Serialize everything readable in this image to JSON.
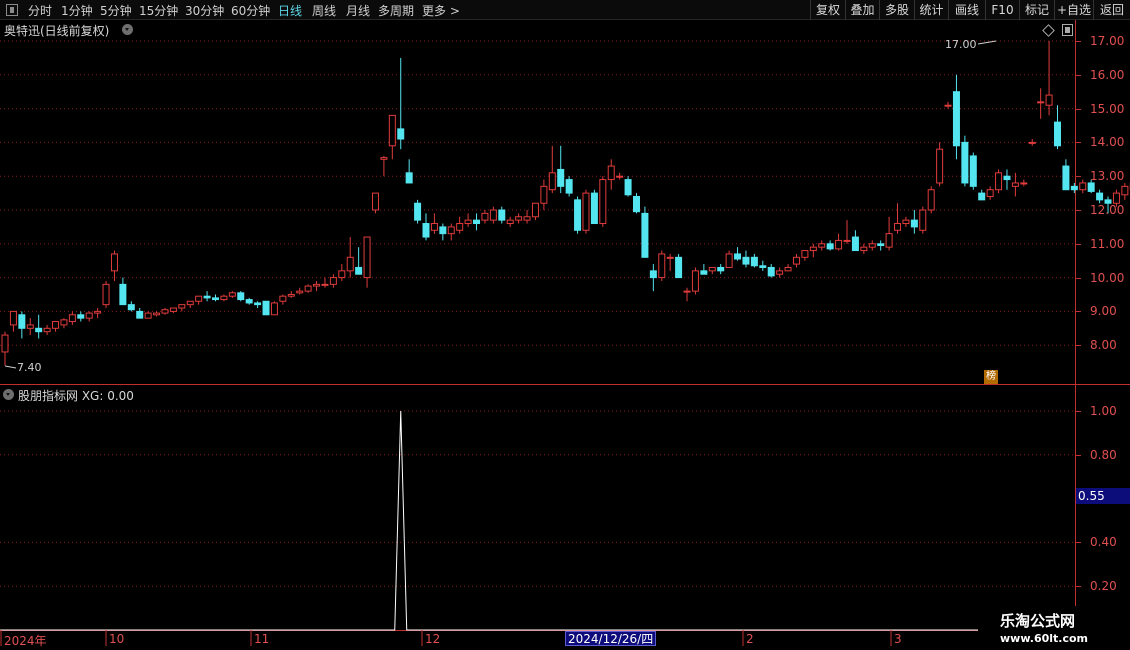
{
  "toolbar": {
    "tabs": [
      {
        "label": "分时"
      },
      {
        "label": "1分钟"
      },
      {
        "label": "5分钟"
      },
      {
        "label": "15分钟"
      },
      {
        "label": "30分钟"
      },
      {
        "label": "60分钟"
      },
      {
        "label": "日线"
      },
      {
        "label": "周线"
      },
      {
        "label": "月线"
      },
      {
        "label": "多周期"
      },
      {
        "label": "更多 >"
      }
    ],
    "active_tab": "日线",
    "right_buttons": [
      "复权",
      "叠加",
      "多股",
      "统计",
      "画线",
      "F10",
      "标记",
      "+自选",
      "返回"
    ]
  },
  "main_pane": {
    "title": "奥特迅(日线前复权)",
    "price_axis_labels": [
      "17.00",
      "16.00",
      "15.00",
      "14.00",
      "13.00",
      "12.00",
      "11.00",
      "10.00",
      "9.00",
      "8.00"
    ],
    "high_marker": "17.00",
    "low_marker": "7.40",
    "badge": "榜"
  },
  "indicator_pane": {
    "title": "股朋指标网 XG: 0.00",
    "axis_labels": [
      "1.00",
      "0.80",
      "0.40",
      "0.20"
    ],
    "cursor_value": "0.55"
  },
  "date_axis": {
    "labels": [
      "2024年",
      "10",
      "11",
      "12",
      "2",
      "3"
    ],
    "highlight": "2024/12/26/四"
  },
  "watermark": {
    "title": "乐淘公式网",
    "url": "www.60lt.com"
  },
  "colors": {
    "up": "#e03c3c",
    "down": "#54e6f0",
    "grid": "#8a1a1a",
    "axis": "#c03030",
    "active_tab": "#5dd6e8"
  },
  "chart_data": {
    "type": "candlestick",
    "price_range": [
      7.4,
      17.0
    ],
    "candles": [
      {
        "o": 7.8,
        "h": 8.4,
        "l": 7.4,
        "c": 8.3
      },
      {
        "o": 8.6,
        "h": 9.0,
        "l": 8.4,
        "c": 9.0
      },
      {
        "o": 8.9,
        "h": 9.0,
        "l": 8.2,
        "c": 8.5
      },
      {
        "o": 8.5,
        "h": 8.8,
        "l": 8.3,
        "c": 8.6
      },
      {
        "o": 8.5,
        "h": 8.9,
        "l": 8.2,
        "c": 8.4
      },
      {
        "o": 8.4,
        "h": 8.6,
        "l": 8.3,
        "c": 8.5
      },
      {
        "o": 8.5,
        "h": 8.7,
        "l": 8.4,
        "c": 8.7
      },
      {
        "o": 8.6,
        "h": 8.8,
        "l": 8.5,
        "c": 8.75
      },
      {
        "o": 8.7,
        "h": 9.0,
        "l": 8.6,
        "c": 8.9
      },
      {
        "o": 8.9,
        "h": 9.0,
        "l": 8.7,
        "c": 8.8
      },
      {
        "o": 8.8,
        "h": 9.0,
        "l": 8.7,
        "c": 8.95
      },
      {
        "o": 8.95,
        "h": 9.1,
        "l": 8.8,
        "c": 9.0
      },
      {
        "o": 9.2,
        "h": 9.9,
        "l": 9.1,
        "c": 9.8
      },
      {
        "o": 10.2,
        "h": 10.8,
        "l": 9.9,
        "c": 10.7
      },
      {
        "o": 9.8,
        "h": 10.0,
        "l": 9.2,
        "c": 9.2
      },
      {
        "o": 9.2,
        "h": 9.3,
        "l": 9.0,
        "c": 9.05
      },
      {
        "o": 9.0,
        "h": 9.1,
        "l": 8.8,
        "c": 8.8
      },
      {
        "o": 8.8,
        "h": 9.0,
        "l": 8.8,
        "c": 8.95
      },
      {
        "o": 8.9,
        "h": 9.0,
        "l": 8.85,
        "c": 8.95
      },
      {
        "o": 8.95,
        "h": 9.1,
        "l": 8.9,
        "c": 9.05
      },
      {
        "o": 9.0,
        "h": 9.1,
        "l": 8.95,
        "c": 9.1
      },
      {
        "o": 9.1,
        "h": 9.2,
        "l": 9.0,
        "c": 9.2
      },
      {
        "o": 9.2,
        "h": 9.3,
        "l": 9.1,
        "c": 9.3
      },
      {
        "o": 9.3,
        "h": 9.4,
        "l": 9.2,
        "c": 9.45
      },
      {
        "o": 9.45,
        "h": 9.6,
        "l": 9.3,
        "c": 9.4
      },
      {
        "o": 9.4,
        "h": 9.5,
        "l": 9.3,
        "c": 9.35
      },
      {
        "o": 9.35,
        "h": 9.5,
        "l": 9.3,
        "c": 9.45
      },
      {
        "o": 9.45,
        "h": 9.6,
        "l": 9.4,
        "c": 9.55
      },
      {
        "o": 9.55,
        "h": 9.6,
        "l": 9.3,
        "c": 9.35
      },
      {
        "o": 9.35,
        "h": 9.4,
        "l": 9.2,
        "c": 9.25
      },
      {
        "o": 9.25,
        "h": 9.3,
        "l": 9.1,
        "c": 9.2
      },
      {
        "o": 9.3,
        "h": 9.3,
        "l": 8.9,
        "c": 8.9
      },
      {
        "o": 8.9,
        "h": 9.3,
        "l": 8.9,
        "c": 9.25
      },
      {
        "o": 9.3,
        "h": 9.5,
        "l": 9.2,
        "c": 9.45
      },
      {
        "o": 9.45,
        "h": 9.6,
        "l": 9.4,
        "c": 9.5
      },
      {
        "o": 9.55,
        "h": 9.7,
        "l": 9.5,
        "c": 9.6
      },
      {
        "o": 9.6,
        "h": 9.8,
        "l": 9.55,
        "c": 9.75
      },
      {
        "o": 9.75,
        "h": 9.9,
        "l": 9.6,
        "c": 9.8
      },
      {
        "o": 9.8,
        "h": 10.0,
        "l": 9.7,
        "c": 9.8
      },
      {
        "o": 9.8,
        "h": 10.1,
        "l": 9.7,
        "c": 10.0
      },
      {
        "o": 10.0,
        "h": 10.4,
        "l": 9.9,
        "c": 10.2
      },
      {
        "o": 10.2,
        "h": 11.2,
        "l": 10.0,
        "c": 10.6
      },
      {
        "o": 10.3,
        "h": 10.9,
        "l": 10.1,
        "c": 10.1
      },
      {
        "o": 10.0,
        "h": 11.2,
        "l": 9.7,
        "c": 11.2
      },
      {
        "o": 12.0,
        "h": 12.5,
        "l": 11.9,
        "c": 12.5
      },
      {
        "o": 13.5,
        "h": 13.6,
        "l": 13.0,
        "c": 13.55
      },
      {
        "o": 13.9,
        "h": 14.8,
        "l": 13.5,
        "c": 14.8
      },
      {
        "o": 14.4,
        "h": 16.5,
        "l": 13.8,
        "c": 14.1
      },
      {
        "o": 13.1,
        "h": 13.5,
        "l": 12.8,
        "c": 12.8
      },
      {
        "o": 12.2,
        "h": 12.3,
        "l": 11.6,
        "c": 11.7
      },
      {
        "o": 11.6,
        "h": 11.9,
        "l": 11.1,
        "c": 11.2
      },
      {
        "o": 11.4,
        "h": 11.9,
        "l": 11.3,
        "c": 11.6
      },
      {
        "o": 11.5,
        "h": 11.6,
        "l": 11.1,
        "c": 11.3
      },
      {
        "o": 11.3,
        "h": 11.6,
        "l": 11.1,
        "c": 11.5
      },
      {
        "o": 11.4,
        "h": 11.8,
        "l": 11.3,
        "c": 11.6
      },
      {
        "o": 11.6,
        "h": 11.9,
        "l": 11.5,
        "c": 11.7
      },
      {
        "o": 11.7,
        "h": 11.9,
        "l": 11.4,
        "c": 11.6
      },
      {
        "o": 11.7,
        "h": 12.0,
        "l": 11.6,
        "c": 11.9
      },
      {
        "o": 11.7,
        "h": 12.1,
        "l": 11.6,
        "c": 12.0
      },
      {
        "o": 12.0,
        "h": 12.1,
        "l": 11.6,
        "c": 11.7
      },
      {
        "o": 11.6,
        "h": 11.8,
        "l": 11.5,
        "c": 11.7
      },
      {
        "o": 11.7,
        "h": 11.9,
        "l": 11.6,
        "c": 11.8
      },
      {
        "o": 11.7,
        "h": 12.0,
        "l": 11.6,
        "c": 11.8
      },
      {
        "o": 11.8,
        "h": 12.2,
        "l": 11.7,
        "c": 12.2
      },
      {
        "o": 12.2,
        "h": 12.9,
        "l": 12.0,
        "c": 12.7
      },
      {
        "o": 12.6,
        "h": 13.9,
        "l": 12.5,
        "c": 13.1
      },
      {
        "o": 13.2,
        "h": 13.9,
        "l": 12.5,
        "c": 12.7
      },
      {
        "o": 12.9,
        "h": 13.0,
        "l": 12.4,
        "c": 12.5
      },
      {
        "o": 12.3,
        "h": 12.4,
        "l": 11.3,
        "c": 11.4
      },
      {
        "o": 11.4,
        "h": 12.6,
        "l": 11.3,
        "c": 12.5
      },
      {
        "o": 12.5,
        "h": 12.6,
        "l": 11.6,
        "c": 11.6
      },
      {
        "o": 11.6,
        "h": 13.0,
        "l": 11.5,
        "c": 12.9
      },
      {
        "o": 12.9,
        "h": 13.5,
        "l": 12.6,
        "c": 13.3
      },
      {
        "o": 13.0,
        "h": 13.1,
        "l": 12.9,
        "c": 13.0
      },
      {
        "o": 12.9,
        "h": 13.0,
        "l": 12.4,
        "c": 12.45
      },
      {
        "o": 12.4,
        "h": 12.5,
        "l": 11.9,
        "c": 11.95
      },
      {
        "o": 11.9,
        "h": 12.1,
        "l": 10.6,
        "c": 10.6
      },
      {
        "o": 10.2,
        "h": 10.4,
        "l": 9.6,
        "c": 10.0
      },
      {
        "o": 10.0,
        "h": 10.8,
        "l": 9.9,
        "c": 10.7
      },
      {
        "o": 10.6,
        "h": 10.7,
        "l": 10.2,
        "c": 10.6
      },
      {
        "o": 10.6,
        "h": 10.7,
        "l": 10.0,
        "c": 10.0
      },
      {
        "o": 9.6,
        "h": 9.7,
        "l": 9.3,
        "c": 9.6
      },
      {
        "o": 9.6,
        "h": 10.3,
        "l": 9.5,
        "c": 10.2
      },
      {
        "o": 10.2,
        "h": 10.4,
        "l": 10.1,
        "c": 10.1
      },
      {
        "o": 10.2,
        "h": 10.3,
        "l": 10.1,
        "c": 10.3
      },
      {
        "o": 10.3,
        "h": 10.4,
        "l": 10.1,
        "c": 10.2
      },
      {
        "o": 10.3,
        "h": 10.8,
        "l": 10.3,
        "c": 10.7
      },
      {
        "o": 10.7,
        "h": 10.9,
        "l": 10.5,
        "c": 10.55
      },
      {
        "o": 10.6,
        "h": 10.8,
        "l": 10.3,
        "c": 10.4
      },
      {
        "o": 10.6,
        "h": 10.7,
        "l": 10.3,
        "c": 10.35
      },
      {
        "o": 10.35,
        "h": 10.5,
        "l": 10.2,
        "c": 10.3
      },
      {
        "o": 10.3,
        "h": 10.4,
        "l": 10.0,
        "c": 10.05
      },
      {
        "o": 10.1,
        "h": 10.3,
        "l": 10.0,
        "c": 10.2
      },
      {
        "o": 10.2,
        "h": 10.4,
        "l": 10.2,
        "c": 10.3
      },
      {
        "o": 10.4,
        "h": 10.7,
        "l": 10.3,
        "c": 10.6
      },
      {
        "o": 10.6,
        "h": 10.8,
        "l": 10.5,
        "c": 10.8
      },
      {
        "o": 10.8,
        "h": 11.0,
        "l": 10.6,
        "c": 10.9
      },
      {
        "o": 10.9,
        "h": 11.1,
        "l": 10.8,
        "c": 11.0
      },
      {
        "o": 11.0,
        "h": 11.1,
        "l": 10.8,
        "c": 10.85
      },
      {
        "o": 10.85,
        "h": 11.3,
        "l": 10.8,
        "c": 11.1
      },
      {
        "o": 11.1,
        "h": 11.7,
        "l": 11.0,
        "c": 11.1
      },
      {
        "o": 11.2,
        "h": 11.4,
        "l": 10.8,
        "c": 10.8
      },
      {
        "o": 10.8,
        "h": 11.0,
        "l": 10.7,
        "c": 10.9
      },
      {
        "o": 10.9,
        "h": 11.1,
        "l": 10.8,
        "c": 11.0
      },
      {
        "o": 11.0,
        "h": 11.1,
        "l": 10.8,
        "c": 10.95
      },
      {
        "o": 10.9,
        "h": 11.8,
        "l": 10.8,
        "c": 11.3
      },
      {
        "o": 11.4,
        "h": 12.2,
        "l": 11.3,
        "c": 11.6
      },
      {
        "o": 11.6,
        "h": 11.8,
        "l": 11.5,
        "c": 11.7
      },
      {
        "o": 11.7,
        "h": 12.0,
        "l": 11.3,
        "c": 11.5
      },
      {
        "o": 11.4,
        "h": 12.1,
        "l": 11.3,
        "c": 12.0
      },
      {
        "o": 12.0,
        "h": 12.7,
        "l": 11.9,
        "c": 12.6
      },
      {
        "o": 12.8,
        "h": 14.0,
        "l": 12.7,
        "c": 13.8
      },
      {
        "o": 15.1,
        "h": 15.2,
        "l": 15.0,
        "c": 15.1
      },
      {
        "o": 15.5,
        "h": 16.0,
        "l": 13.5,
        "c": 13.9
      },
      {
        "o": 14.0,
        "h": 14.2,
        "l": 12.7,
        "c": 12.8
      },
      {
        "o": 13.6,
        "h": 13.7,
        "l": 12.6,
        "c": 12.7
      },
      {
        "o": 12.5,
        "h": 12.6,
        "l": 12.3,
        "c": 12.3
      },
      {
        "o": 12.4,
        "h": 12.7,
        "l": 12.3,
        "c": 12.6
      },
      {
        "o": 12.6,
        "h": 13.2,
        "l": 12.5,
        "c": 13.1
      },
      {
        "o": 13.0,
        "h": 13.2,
        "l": 12.6,
        "c": 12.9
      },
      {
        "o": 12.7,
        "h": 13.1,
        "l": 12.4,
        "c": 12.8
      },
      {
        "o": 12.8,
        "h": 12.9,
        "l": 12.7,
        "c": 12.8
      },
      {
        "o": 14.0,
        "h": 14.1,
        "l": 13.9,
        "c": 14.0
      },
      {
        "o": 15.2,
        "h": 15.6,
        "l": 14.7,
        "c": 15.2
      },
      {
        "o": 15.1,
        "h": 17.0,
        "l": 14.8,
        "c": 15.4
      },
      {
        "o": 14.6,
        "h": 15.1,
        "l": 13.8,
        "c": 13.9
      },
      {
        "o": 13.3,
        "h": 13.5,
        "l": 12.6,
        "c": 12.6
      },
      {
        "o": 12.7,
        "h": 12.8,
        "l": 12.5,
        "c": 12.6
      },
      {
        "o": 12.6,
        "h": 12.9,
        "l": 12.5,
        "c": 12.8
      },
      {
        "o": 12.8,
        "h": 12.9,
        "l": 12.5,
        "c": 12.55
      },
      {
        "o": 12.5,
        "h": 12.6,
        "l": 12.2,
        "c": 12.3
      },
      {
        "o": 12.3,
        "h": 12.4,
        "l": 11.9,
        "c": 12.2
      },
      {
        "o": 12.2,
        "h": 12.6,
        "l": 12.1,
        "c": 12.5
      },
      {
        "o": 12.45,
        "h": 12.8,
        "l": 12.3,
        "c": 12.7
      },
      {
        "o": 12.6,
        "h": 12.9,
        "l": 12.5,
        "c": 12.8
      }
    ],
    "indicator": {
      "name": "XG",
      "signal_index": 47,
      "signal_value": 1.0,
      "ylim": [
        0,
        1.0
      ]
    }
  }
}
